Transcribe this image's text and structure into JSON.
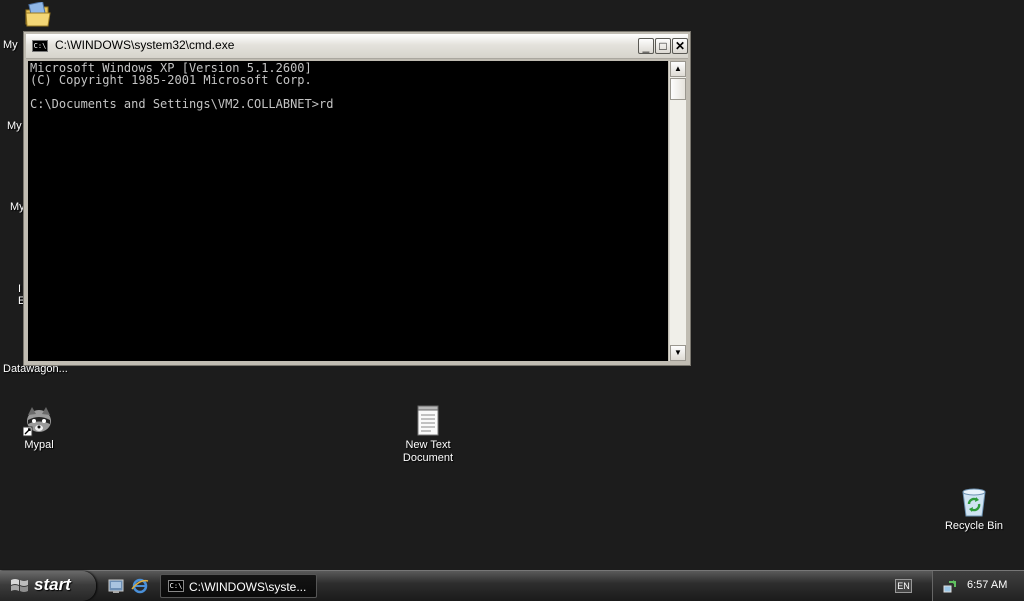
{
  "desktop": {
    "partial_labels": [
      "My",
      "My",
      "My",
      "I",
      "E"
    ],
    "datawagon_label": "Datawagon...",
    "icons": {
      "mypal": "Mypal",
      "new_text_document": "New Text Document",
      "recycle_bin": "Recycle Bin"
    }
  },
  "window": {
    "title": "C:\\WINDOWS\\system32\\cmd.exe",
    "icon_glyph": "C:\\",
    "buttons": {
      "minimize": "_",
      "maximize": "□",
      "close": "✕"
    },
    "console_lines": [
      "Microsoft Windows XP [Version 5.1.2600]",
      "(C) Copyright 1985-2001 Microsoft Corp.",
      "",
      "C:\\Documents and Settings\\VM2.COLLABNET>rd"
    ],
    "scroll_up": "▲",
    "scroll_down": "▼"
  },
  "taskbar": {
    "start_label": "start",
    "task_button_label": "C:\\WINDOWS\\syste...",
    "language": "EN",
    "clock": "6:57 AM"
  },
  "colors": {
    "desktop_bg": "#1c1c1c",
    "console_bg": "#000000",
    "console_text": "#c4c4c4"
  }
}
